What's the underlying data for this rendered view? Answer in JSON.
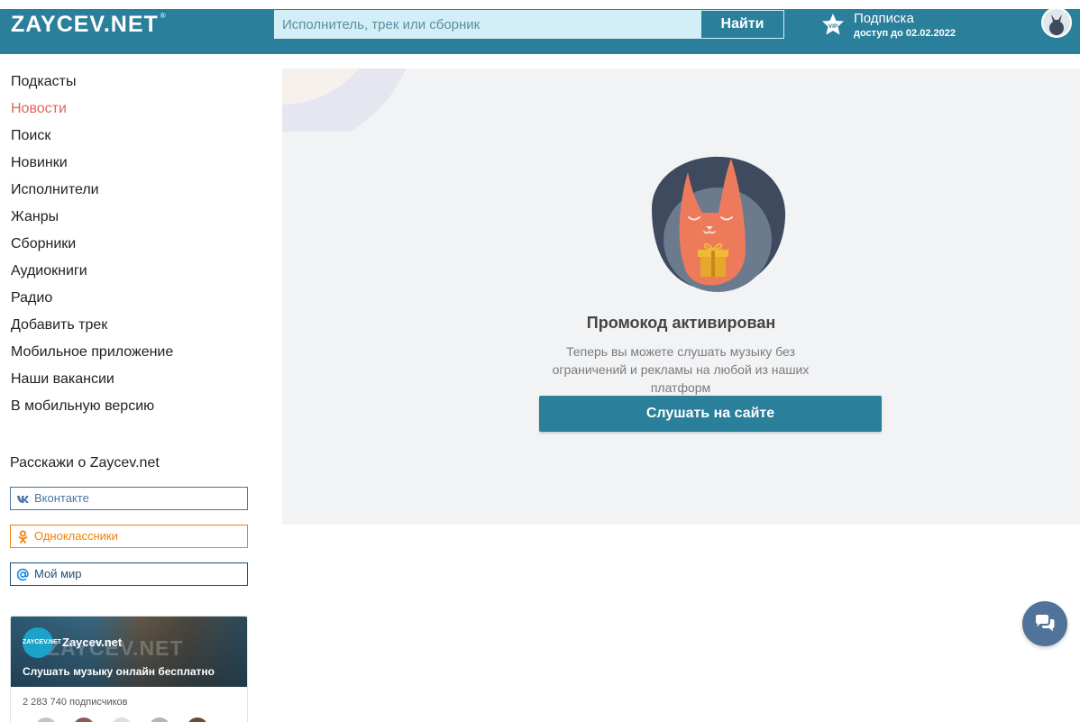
{
  "header": {
    "logo": "ZAYCEV.NET",
    "logo_mark": "®",
    "search_placeholder": "Исполнитель, трек или сборник",
    "search_button": "Найти",
    "vip_icon_label": "VIP",
    "vip_title": "Подписка",
    "vip_subtitle": "доступ до 02.02.2022"
  },
  "sidebar": {
    "items": [
      {
        "label": "Подкасты"
      },
      {
        "label": "Новости",
        "active": true
      },
      {
        "label": "Поиск"
      },
      {
        "label": "Новинки"
      },
      {
        "label": "Исполнители"
      },
      {
        "label": "Жанры"
      },
      {
        "label": "Сборники"
      },
      {
        "label": "Аудиокниги"
      },
      {
        "label": "Радио"
      },
      {
        "label": "Добавить трек"
      },
      {
        "label": "Мобильное приложение"
      },
      {
        "label": "Наши вакансии"
      },
      {
        "label": "В мобильную версию"
      }
    ],
    "share_title": "Расскажи о Zaycev.net",
    "share": {
      "vk": "Вконтакте",
      "ok": "Одноклассники",
      "mm": "Мой мир"
    },
    "widget": {
      "logo_text": "ZAYCEV.NET",
      "ghost_text": "ZAYCEV.NET",
      "name": "Zaycev.net",
      "description": "Слушать музыку онлайн бесплатно",
      "subscribers": "2 283 740 подписчиков"
    }
  },
  "main": {
    "title": "Промокод активирован",
    "text": "Теперь вы можете слушать музыку без ограничений и рекламы на любой из наших платформ",
    "button": "Слушать на сайте"
  },
  "colors": {
    "brand": "#2a7f9b",
    "active_nav": "#e0635a",
    "vk": "#4c75a3",
    "ok": "#ee8208",
    "mm": "#1c4f7a",
    "card_bg": "#f2f3f5",
    "chat": "#507399"
  },
  "icons": {
    "vip": "vip-star-icon",
    "avatar": "rabbit-avatar-icon",
    "vk": "vk-icon",
    "ok": "odnoklassniki-icon",
    "mm": "at-sign-icon",
    "chat": "chat-bubbles-icon",
    "promo": "rabbit-gift-illustration"
  }
}
